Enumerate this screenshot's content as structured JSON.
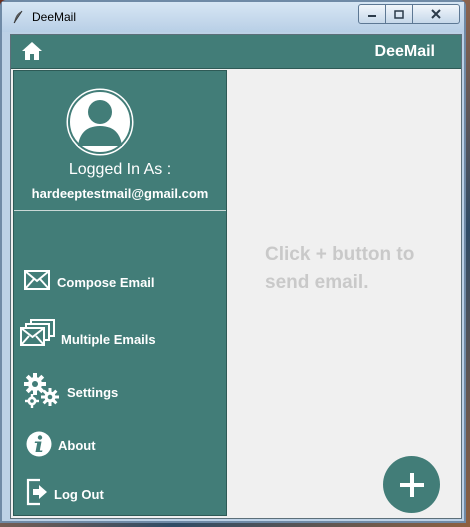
{
  "window": {
    "title": "DeeMail"
  },
  "header": {
    "app_title": "DeeMail"
  },
  "profile": {
    "logged_in_label": "Logged In As :",
    "email": "hardeeptestmail@gmail.com"
  },
  "nav": [
    {
      "label": "Compose Email",
      "icon": "envelope-icon"
    },
    {
      "label": "Multiple Emails",
      "icon": "multiple-envelopes-icon"
    },
    {
      "label": "Settings",
      "icon": "gears-icon"
    },
    {
      "label": "About",
      "icon": "info-icon"
    },
    {
      "label": "Log Out",
      "icon": "logout-icon"
    }
  ],
  "content": {
    "empty_message": "Click + button to send email."
  },
  "fab": {
    "symbol": "+"
  },
  "colors": {
    "accent": "#427d78",
    "muted_text": "#c9c9c9"
  }
}
